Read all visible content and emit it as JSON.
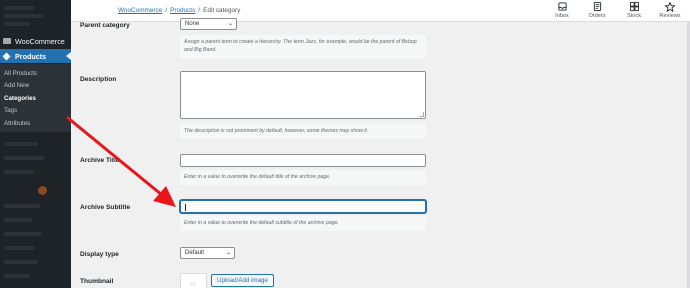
{
  "sidebar": {
    "woocommerce_label": "WooCommerce",
    "products_label": "Products",
    "submenu": [
      {
        "label": "All Products",
        "active": false
      },
      {
        "label": "Add New",
        "active": false
      },
      {
        "label": "Categories",
        "active": true
      },
      {
        "label": "Tags",
        "active": false
      },
      {
        "label": "Attributes",
        "active": false
      }
    ]
  },
  "breadcrumb": {
    "root": "WooCommerce",
    "section": "Products",
    "current": "Edit category",
    "separator": "/"
  },
  "toolbar": {
    "items": [
      {
        "label": "Inbox",
        "icon": "inbox-icon"
      },
      {
        "label": "Orders",
        "icon": "orders-icon"
      },
      {
        "label": "Stock",
        "icon": "stock-icon"
      },
      {
        "label": "Reviews",
        "icon": "star-icon"
      }
    ]
  },
  "form": {
    "parent_category": {
      "label": "Parent category",
      "value": "None",
      "help": "Assign a parent term to create a hierarchy. The term Jazz, for example, would be the parent of Bebop and Big Band."
    },
    "description": {
      "label": "Description",
      "value": "",
      "help": "The description is not prominent by default; however, some themes may show it."
    },
    "archive_title": {
      "label": "Archive Title",
      "value": "",
      "help": "Enter in a value to overwrite the default title of the archive page."
    },
    "archive_subtitle": {
      "label": "Archive Subtitle",
      "value": "",
      "help": "Enter in a value to overwrite the default subtitle of the archive page."
    },
    "display_type": {
      "label": "Display type",
      "value": "Default"
    },
    "thumbnail": {
      "label": "Thumbnail",
      "button": "Upload/Add image"
    }
  },
  "colors": {
    "accent": "#2271b1",
    "sidebar_bg": "#1d2327",
    "annotation_arrow": "#e8161a"
  }
}
